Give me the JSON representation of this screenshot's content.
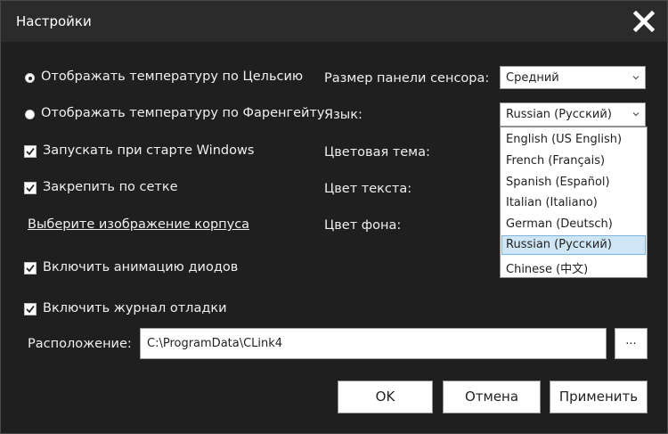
{
  "window": {
    "title": "Настройки"
  },
  "options": {
    "celsius": "Отображать температуру по Цельсию",
    "fahrenheit": "Отображать температуру по Фаренгейту",
    "start_windows": "Запускать при старте Windows",
    "snap_grid": "Закрепить по сетке",
    "choose_image": "Выберите изображение корпуса",
    "led_animation": "Включить анимацию диодов",
    "debug_log": "Включить журнал отладки"
  },
  "labels": {
    "panel_size": "Размер панели сенсора:",
    "language": "Язык:",
    "color_theme": "Цветовая тема:",
    "text_color": "Цвет текста:",
    "bg_color": "Цвет фона:",
    "location": "Расположение:"
  },
  "selects": {
    "panel_size": "Средний",
    "language": "Russian (Русский)"
  },
  "language_options": [
    "English (US English)",
    "French (Français)",
    "Spanish (Español)",
    "Italian (Italiano)",
    "German (Deutsch)",
    "Russian (Русский)",
    "Chinese (中文)"
  ],
  "path": {
    "value": "C:\\ProgramData\\CLink4",
    "browse_label": "..."
  },
  "buttons": {
    "ok": "OK",
    "cancel": "Отмена",
    "apply": "Применить"
  }
}
